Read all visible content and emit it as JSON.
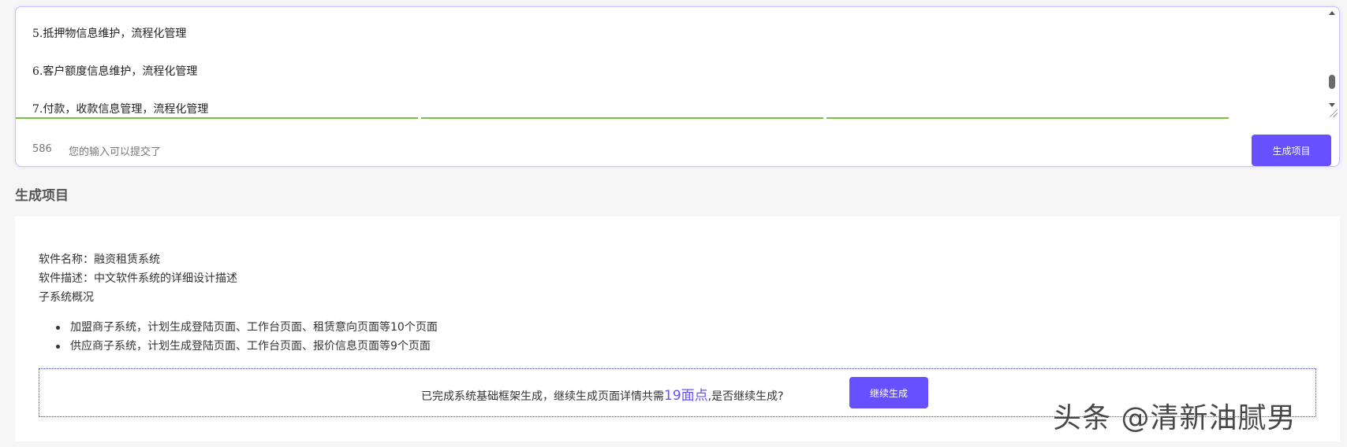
{
  "input": {
    "lines": [
      "5.抵押物信息维护，流程化管理",
      "6.客户额度信息维护，流程化管理",
      "7.付款，收款信息管理，流程化管理"
    ],
    "char_count": "586",
    "hint": "您的输入可以提交了",
    "generate_label": "生成项目"
  },
  "section": {
    "title": "生成项目"
  },
  "result": {
    "software_name": "软件名称：融资租赁系统",
    "software_desc": "软件描述：中文软件系统的详细设计描述",
    "subsystem_heading": "子系统概况",
    "subsystems": [
      "加盟商子系统，计划生成登陆页面、工作台页面、租赁意向页面等10个页面",
      "供应商子系统，计划生成登陆页面、工作台页面、报价信息页面等9个页面"
    ],
    "continue_prefix": "已完成系统基础框架生成，继续生成页面详情共需",
    "continue_points": "19面点",
    "continue_suffix": ",是否继续生成?",
    "continue_label": "继续生成"
  },
  "watermark": "头条 @清新油腻男",
  "colors": {
    "accent": "#6650ff",
    "input_border": "#c9c2ff",
    "progress_green": "#79c142"
  }
}
